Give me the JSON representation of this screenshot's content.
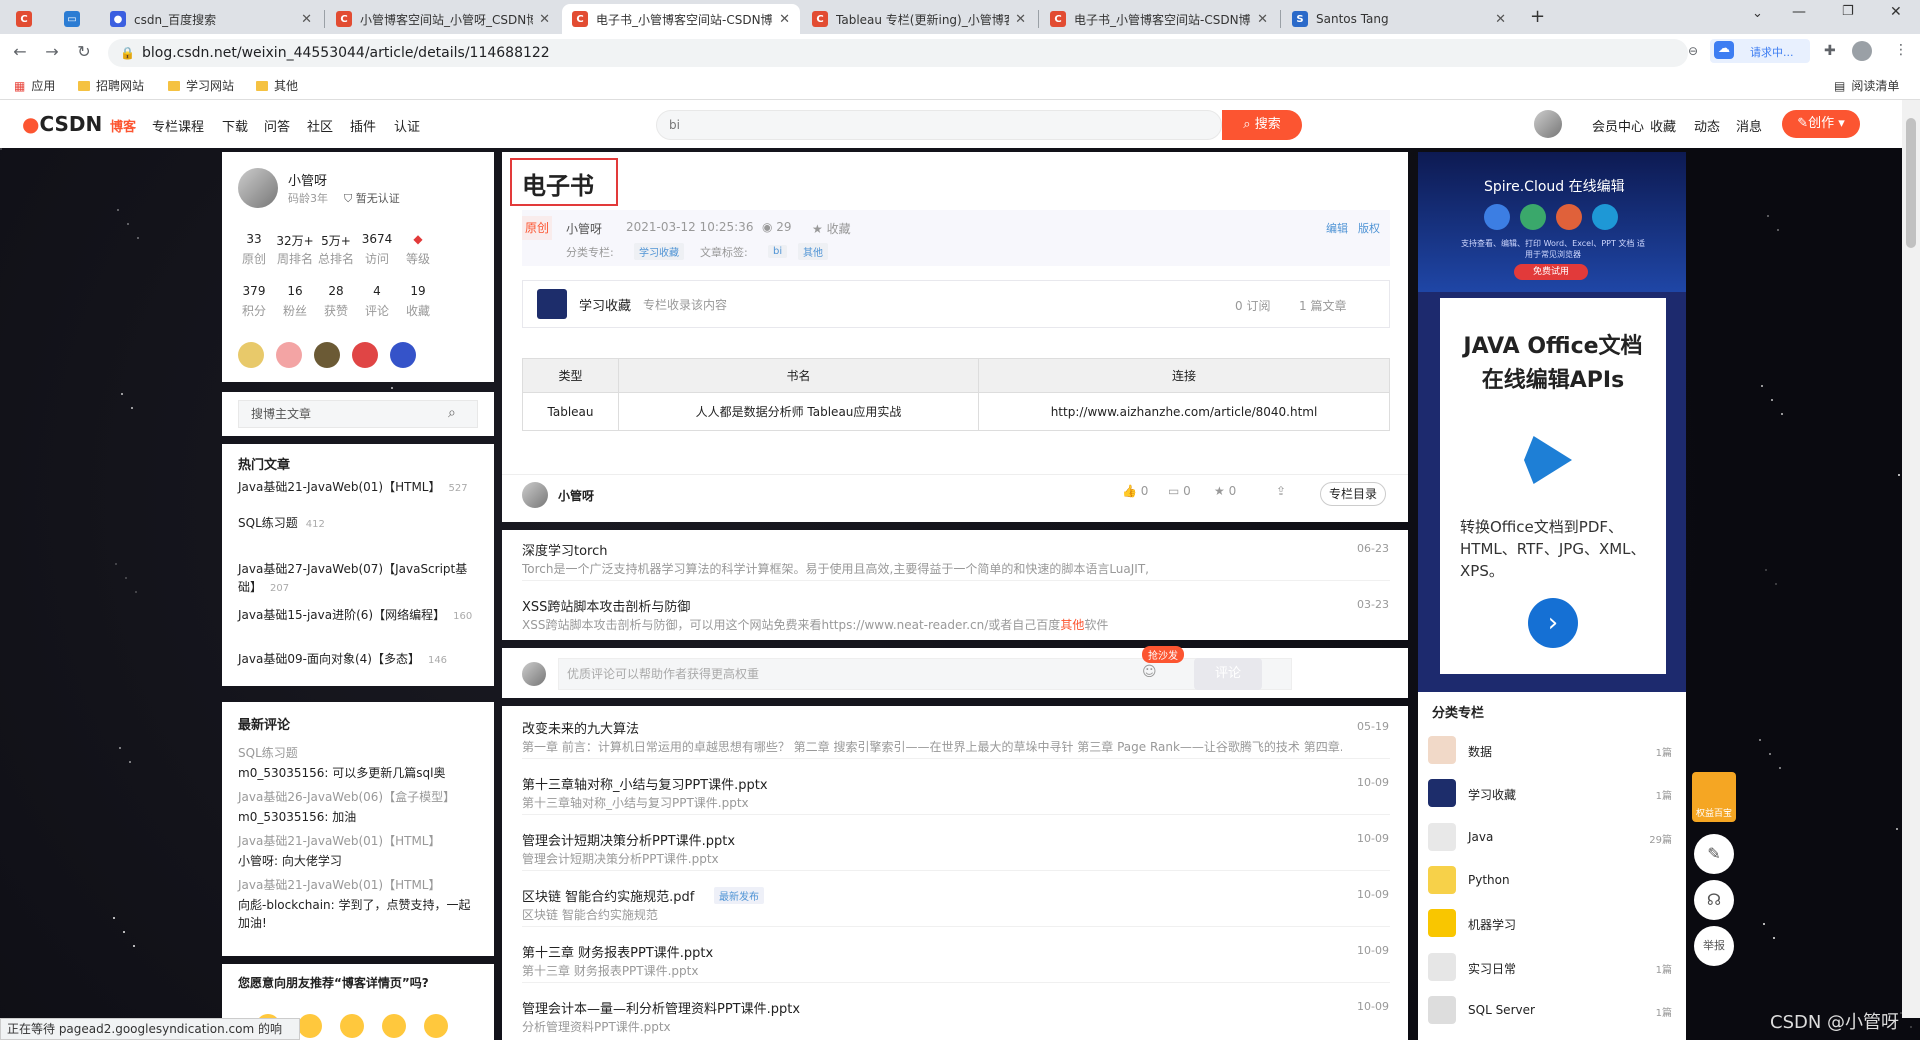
{
  "browser": {
    "tabs": [
      {
        "title": "",
        "color": "#e24c32",
        "glyph": "C"
      },
      {
        "title": "",
        "color": "#2b7cd3",
        "glyph": "▭"
      },
      {
        "title": "csdn_百度搜索",
        "color": "#3b5fe0",
        "glyph": "🐾"
      },
      {
        "title": "小管博客空间站_小管呀_CSDN博",
        "color": "#e24c32",
        "glyph": "C"
      },
      {
        "title": "电子书_小管博客空间站-CSDN博",
        "color": "#e24c32",
        "glyph": "C",
        "active": true
      },
      {
        "title": "Tableau 专栏(更新ing)_小管博客",
        "color": "#e24c32",
        "glyph": "C"
      },
      {
        "title": "电子书_小管博客空间站-CSDN博",
        "color": "#e24c32",
        "glyph": "C"
      },
      {
        "title": "Santos Tang",
        "color": "#2b6ac9",
        "glyph": "S"
      }
    ],
    "new_tab": "+",
    "url": "blog.csdn.net/weixin_44553044/article/details/114688122",
    "ext_badge": "请求中...",
    "bookmarks": [
      "应用",
      "招聘网站",
      "学习网站",
      "其他"
    ],
    "reading_list": "阅读清单",
    "status_text": "正在等待 pagead2.googlesyndication.com 的响应..."
  },
  "csdn": {
    "logo": "CSDN",
    "menu": [
      "博客",
      "专栏课程",
      "下载",
      "问答",
      "社区",
      "插件",
      "认证"
    ],
    "search_value": "bi",
    "search_btn": "搜索",
    "right_menu": [
      "会员中心",
      "收藏",
      "动态",
      "消息"
    ],
    "create_btn": "创作"
  },
  "profile": {
    "name": "小管呀",
    "code_age": "码龄3年",
    "verify": "暂无认证",
    "stats1": [
      {
        "v": "33",
        "l": "原创"
      },
      {
        "v": "32万+",
        "l": "周排名"
      },
      {
        "v": "5万+",
        "l": "总排名"
      },
      {
        "v": "3674",
        "l": "访问"
      },
      {
        "v": "",
        "l": "等级"
      }
    ],
    "stats2": [
      {
        "v": "379",
        "l": "积分"
      },
      {
        "v": "16",
        "l": "粉丝"
      },
      {
        "v": "28",
        "l": "获赞"
      },
      {
        "v": "4",
        "l": "评论"
      },
      {
        "v": "19",
        "l": "收藏"
      }
    ]
  },
  "search_blog": {
    "placeholder": "搜博主文章"
  },
  "hot": {
    "title": "热门文章",
    "items": [
      {
        "t": "Java基础21-JavaWeb(01)【HTML】",
        "c": "527"
      },
      {
        "t": "SQL练习题",
        "c": "412"
      },
      {
        "t": "Java基础27-JavaWeb(07)【JavaScript基础】",
        "c": "207"
      },
      {
        "t": "Java基础15-java进阶(6)【网络编程】",
        "c": "160"
      },
      {
        "t": "Java基础09-面向对象(4)【多态】",
        "c": "146"
      }
    ]
  },
  "comments": {
    "title": "最新评论",
    "items": [
      {
        "a": "SQL练习题",
        "b": "m0_53035156: 可以多更新几篇sql奥"
      },
      {
        "a": "Java基础26-JavaWeb(06)【盒子模型】",
        "b": "m0_53035156: 加油"
      },
      {
        "a": "Java基础21-JavaWeb(01)【HTML】",
        "b": "小管呀: 向大佬学习"
      },
      {
        "a": "Java基础21-JavaWeb(01)【HTML】",
        "b": "向彪-blockchain: 学到了，点赞支持，一起加油!"
      }
    ]
  },
  "recommend_q": "您愿意向朋友推荐“博客详情页”吗?",
  "article": {
    "title": "电子书",
    "badge": "原创",
    "author": "小管呀",
    "date": "2021-03-12 10:25:36",
    "views": "29",
    "fav": "收藏",
    "edit": "编辑",
    "copyright": "版权",
    "cat_label": "分类专栏:",
    "cat_tag": "学习收藏",
    "tag_label": "文章标签:",
    "tags": [
      "bi",
      "其他"
    ],
    "column": {
      "name": "学习收藏",
      "desc": "专栏收录该内容",
      "subs": "0 订阅",
      "count": "1 篇文章"
    },
    "table": {
      "headers": [
        "类型",
        "书名",
        "连接"
      ],
      "rows": [
        [
          "Tableau",
          "人人都是数据分析师 Tableau应用实战",
          "http://www.aizhanzhe.com/article/8040.html"
        ]
      ]
    },
    "footer": {
      "author": "小管呀",
      "like": "0",
      "comment": "0",
      "collect": "0",
      "catalog": "专栏目录"
    }
  },
  "related": [
    {
      "t": "深度学习torch",
      "d": "06-23",
      "desc": "Torch是一个广泛支持机器学习算法的科学计算框架。易于使用且高效,主要得益于一个简单的和快速的脚本语言LuaJIT,"
    },
    {
      "t": "XSS跨站脚本攻击剖析与防御",
      "d": "03-23",
      "desc": "XSS跨站脚本攻击剖析与防御，可以用这个网站免费来看https://www.neat-reader.cn/或者自己百度",
      "hl": "其他",
      "tail": "软件"
    }
  ],
  "comment_box": {
    "placeholder": "优质评论可以帮助作者获得更高权重",
    "badge": "抢沙发",
    "btn": "评论"
  },
  "related2": [
    {
      "t": "改变未来的九大算法",
      "d": "05-19",
      "desc": "第一章 前言：计算机日常运用的卓越思想有哪些？ 第二章 搜索引擎索引——在世界上最大的草垛中寻针 第三章 Page Rank——让谷歌腾飞的技术 第四章..."
    },
    {
      "t": "第十三章轴对称_小结与复习PPT课件.pptx",
      "d": "10-09",
      "desc": "第十三章轴对称_小结与复习PPT课件.pptx"
    },
    {
      "t": "管理会计短期决策分析PPT课件.pptx",
      "d": "10-09",
      "desc": "管理会计短期决策分析PPT课件.pptx"
    },
    {
      "t": "区块链 智能合约实施规范.pdf",
      "d": "10-09",
      "desc": "区块链 智能合约实施规范",
      "badge": "最新发布"
    },
    {
      "t": "第十三章 财务报表PPT课件.pptx",
      "d": "10-09",
      "desc": "第十三章 财务报表PPT课件.pptx"
    },
    {
      "t": "管理会计本—量—利分析管理资料PPT课件.pptx",
      "d": "10-09",
      "desc": "分析管理资料PPT课件.pptx"
    }
  ],
  "ad": {
    "brand": "Spire.Cloud 在线编辑",
    "sub": "支持查看、编辑、打印 Word、Excel、PPT 文档 适用于常见浏览器",
    "try": "免费试用",
    "head1": "JAVA Office文档",
    "head2": "在线编辑APIs",
    "desc": "转换Office文档到PDF、HTML、RTF、JPG、XML、XPS。"
  },
  "categories": {
    "title": "分类专栏",
    "items": [
      {
        "n": "数据",
        "c": "1篇"
      },
      {
        "n": "学习收藏",
        "c": "1篇"
      },
      {
        "n": "Java",
        "c": "29篇"
      },
      {
        "n": "Python",
        "c": ""
      },
      {
        "n": "机器学习",
        "c": ""
      },
      {
        "n": "实习日常",
        "c": "1篇"
      },
      {
        "n": "SQL Server",
        "c": "1篇"
      }
    ]
  },
  "float_tools": {
    "report": "举报",
    "gift": "权益百宝"
  },
  "watermark": "CSDN @小管呀"
}
